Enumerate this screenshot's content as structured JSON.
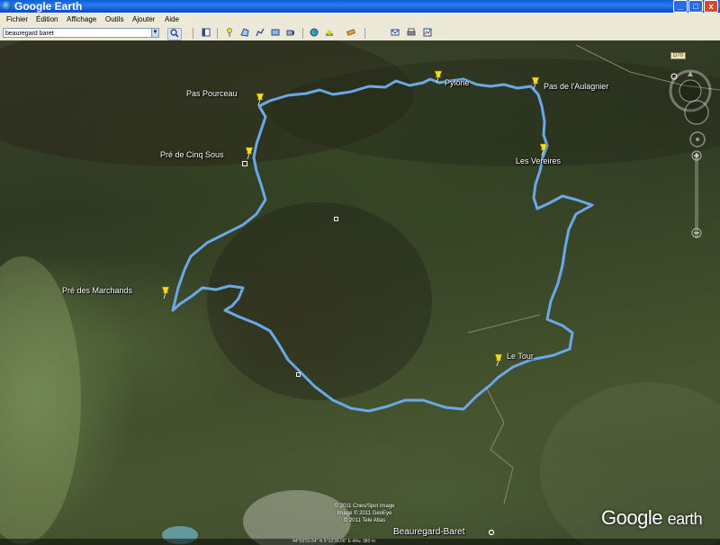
{
  "window": {
    "title": "Google Earth",
    "minimize": "_",
    "maximize": "□",
    "close": "x"
  },
  "menu": [
    "Fichier",
    "Édition",
    "Affichage",
    "Outils",
    "Ajouter",
    "Aide"
  ],
  "search": {
    "value": "beauregard baret"
  },
  "toolbar_icons": [
    "sidebar-icon",
    "placemark-icon",
    "polygon-icon",
    "path-icon",
    "overlay-icon",
    "tour-icon",
    "sky-icon",
    "sun-icon",
    "planet-icon",
    "ruler-icon",
    "email-icon",
    "print-icon",
    "view-in-maps-icon"
  ],
  "places": {
    "pylone": "Pylône",
    "pas_aulagnier": "Pas de l'Aulagnier",
    "pas_pourceau": "Pas Pourceau",
    "pre_cinq_sous": "Pré de Cinq Sous",
    "les_vereires": "Les Vereires",
    "pre_marchands": "Pré des Marchands",
    "le_tour": "Le Tour",
    "beauregard": "Beauregard-Baret"
  },
  "road_label": "D70",
  "copyright": [
    "© 2011 Cnes/Spot Image",
    "Image © 2011 GeoEye",
    "© 2011 Tele Atlas"
  ],
  "logo": {
    "google": "Google",
    "earth": "earth"
  },
  "status": "44°59'53.54\" N   5°10'39.06\" E   élév. 380 m",
  "colors": {
    "track": "#4a90d9",
    "titlebar": "#0a5fd8",
    "pin": "#f0e020"
  }
}
